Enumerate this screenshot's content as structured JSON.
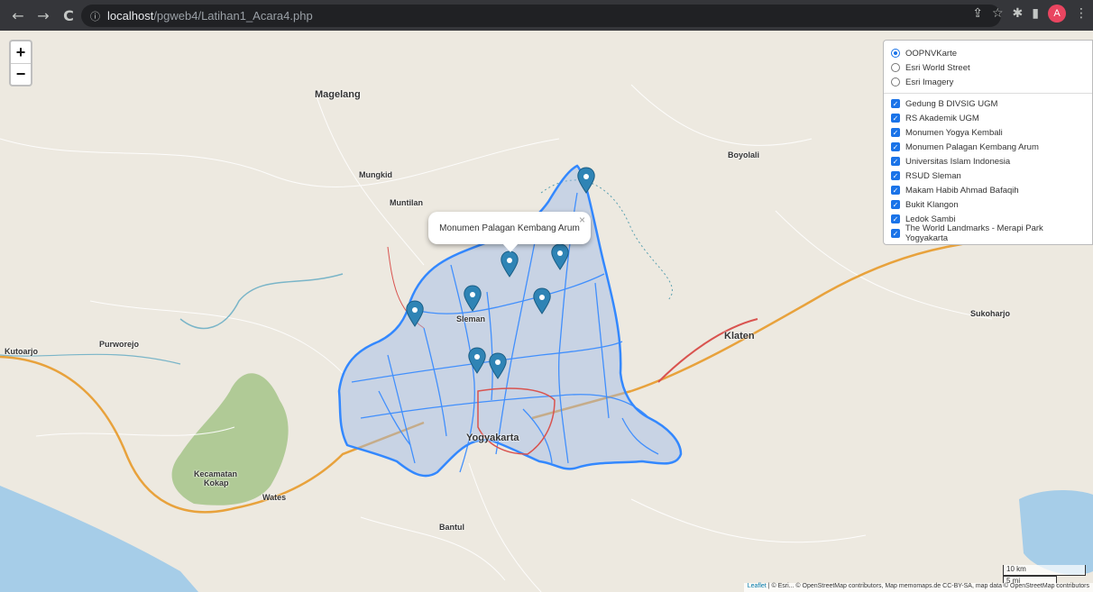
{
  "browser": {
    "nav_back": "←",
    "nav_forward": "→",
    "reload": "C",
    "info_icon": "ⓘ",
    "url_host": "localhost",
    "url_path": "/pgweb4/Latihan1_Acara4.php",
    "avatar_letter": "A"
  },
  "map": {
    "zoom_in": "+",
    "zoom_out": "−",
    "popup_text": "Monumen Palagan Kembang Arum",
    "popup_close": "×",
    "basemaps": [
      {
        "label": "OOPNVKarte",
        "selected": true
      },
      {
        "label": "Esri World Street",
        "selected": false
      },
      {
        "label": "Esri Imagery",
        "selected": false
      }
    ],
    "overlays": [
      {
        "label": "Gedung B DIVSIG UGM",
        "checked": true
      },
      {
        "label": "RS Akademik UGM",
        "checked": true
      },
      {
        "label": "Monumen Yogya Kembali",
        "checked": true
      },
      {
        "label": "Monumen Palagan Kembang Arum",
        "checked": true
      },
      {
        "label": "Universitas Islam Indonesia",
        "checked": true
      },
      {
        "label": "RSUD Sleman",
        "checked": true
      },
      {
        "label": "Makam Habib Ahmad Bafaqih",
        "checked": true
      },
      {
        "label": "Bukit Klangon",
        "checked": true
      },
      {
        "label": "Ledok Sambi",
        "checked": true
      },
      {
        "label": "The World Landmarks - Merapi Park Yogyakarta",
        "checked": true
      }
    ],
    "place_labels": {
      "magelang": "Magelang",
      "mungkid": "Mungkid",
      "muntilan": "Muntilan",
      "boyolali": "Boyolali",
      "sukoharjo": "Sukoharjo",
      "klaten": "Klaten",
      "sleman": "Sleman",
      "yogyakarta": "Yogyakarta",
      "kutoarjo": "Kutoarjo",
      "purworejo": "Purworejo",
      "kecamatan": "Kecamatan",
      "kokap": "Kokap",
      "wates": "Wates",
      "bantul": "Bantul"
    },
    "scale": {
      "km": "10 km",
      "mi": "5 mi"
    },
    "attribution_link": "Leaflet",
    "attribution_text": "| © Esri... © OpenStreetMap contributors, Map memomaps.de CC-BY-SA, map data © OpenStreetMap contributors"
  },
  "colors": {
    "polygon_stroke": "#3388ff",
    "polygon_fill": "#9cb8e8",
    "marker": "#2f84b5",
    "water": "#a6cde8",
    "forest": "#a8c78e"
  }
}
